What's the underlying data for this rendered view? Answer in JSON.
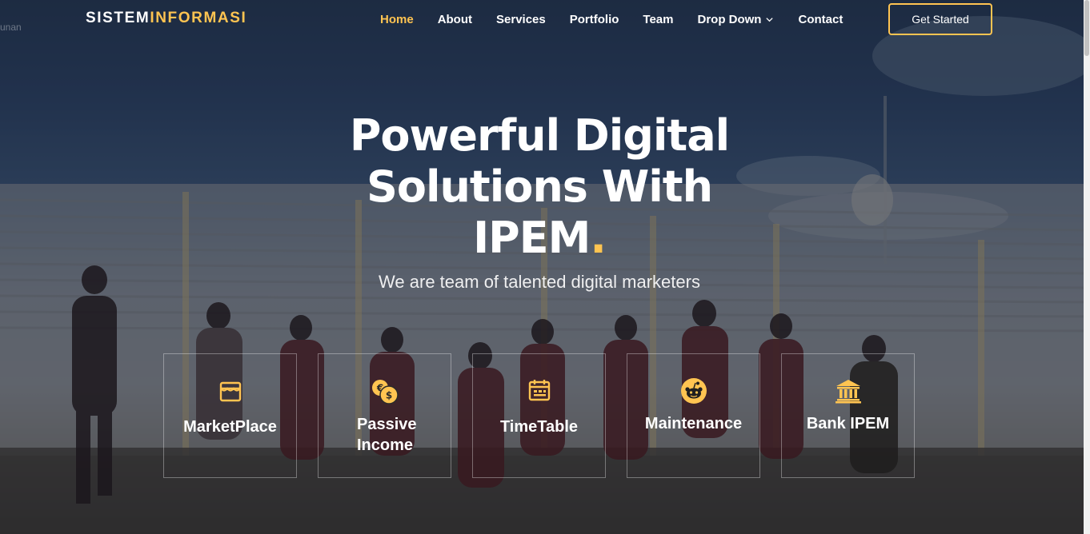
{
  "brand": {
    "part1": "SISTEM",
    "part2": "INFORMASI"
  },
  "nav": {
    "items": [
      {
        "label": "Home",
        "active": true
      },
      {
        "label": "About"
      },
      {
        "label": "Services"
      },
      {
        "label": "Portfolio"
      },
      {
        "label": "Team"
      },
      {
        "label": "Drop Down",
        "has_dropdown": true
      },
      {
        "label": "Contact"
      }
    ],
    "cta": "Get Started"
  },
  "hero": {
    "title_line1": "Powerful Digital",
    "title_line2": "Solutions With",
    "title_line3": "IPEM",
    "title_dot": ".",
    "subtitle": "We are team of talented digital marketers",
    "faint_text": "unan"
  },
  "features": [
    {
      "label_1": "MarketPlace",
      "label_2": "",
      "icon": "store-icon"
    },
    {
      "label_1": "Passive",
      "label_2": "Income",
      "icon": "currency-exchange-icon"
    },
    {
      "label_1": "TimeTable",
      "label_2": "",
      "icon": "calendar-icon"
    },
    {
      "label_1": "Maintenance",
      "label_2": "",
      "icon": "reddit-icon"
    },
    {
      "label_1": "Bank IPEM",
      "label_2": "",
      "icon": "bank-icon"
    }
  ],
  "colors": {
    "accent": "#ffc451",
    "text": "#ffffff"
  }
}
